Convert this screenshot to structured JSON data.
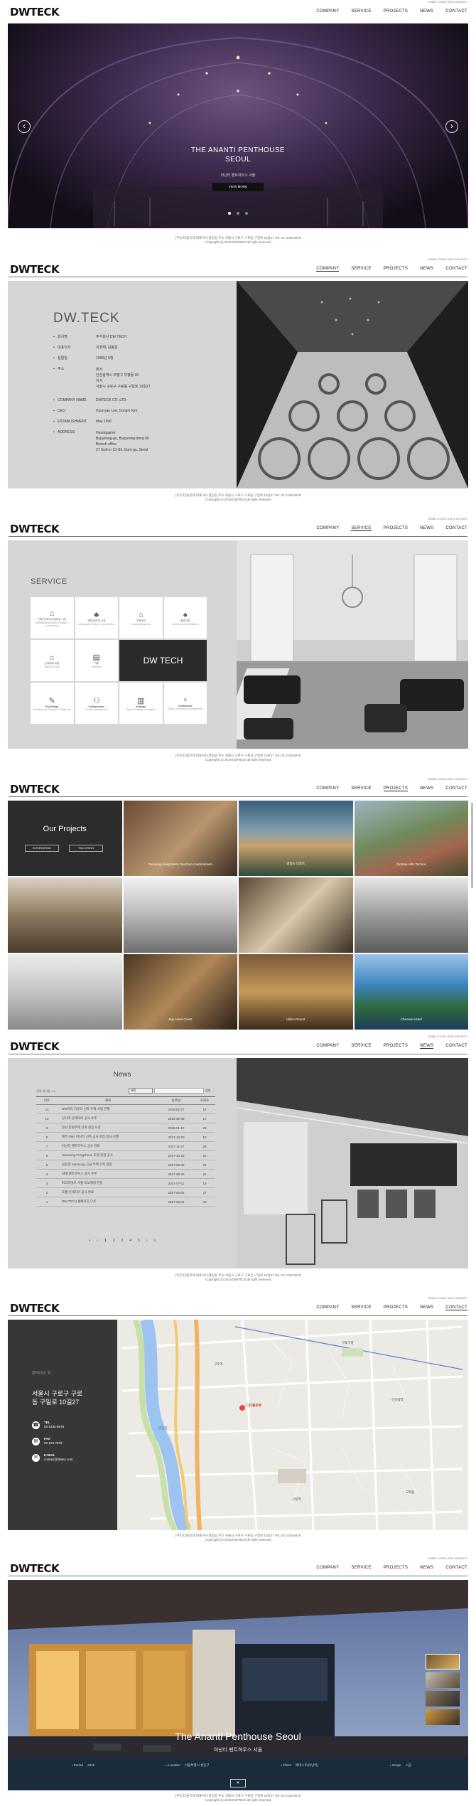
{
  "brand": "DWTECK",
  "nav": [
    "COMPANY",
    "SERVICE",
    "PROJECTS",
    "NEWS",
    "CONTACT"
  ],
  "util": "HOME  LOGIN  JOIN  CONTACT",
  "footer": {
    "line1": "(주)디더블유텍 대표이사 홍길동 주소 서울시 구로구 구로동 구일로 10길27 Tel. 02-1234-5678",
    "line2": "Copyright (c) 2018 DWTECK all right reserved"
  },
  "hero": {
    "title1": "THE ANANTI PENTHOUSE",
    "title2": "SEOUL",
    "sub": "아난티 펜트하우스 서울",
    "btn": "VIEW MORE",
    "prev": "‹",
    "next": "›"
  },
  "company": {
    "title": "DW.TECK",
    "rows": [
      {
        "k": "회사명",
        "v": "주식회사 DW TECH"
      },
      {
        "k": "대표이사",
        "v": "이현재, 김동일"
      },
      {
        "k": "설립일",
        "v": "1996년 5월"
      },
      {
        "k": "주소",
        "v": "본사\n인천광역시 부평구 부평동 00\n지사\n서울시 구로구 구로동 구일로 10길27"
      },
      {
        "k": "COMPANY NAME",
        "v": "DWTECK CO.,LTD."
      },
      {
        "k": "CEO",
        "v": "Hyun-jae Lee, Dong-il Kim"
      },
      {
        "k": "ESTABLISHMENT",
        "v": "May 1996"
      },
      {
        "k": "ADDRESS",
        "v": "Headquarter\nBupyeong-gu, Bupyeong-dong 00\nBranch office\n27 Guil-ro 10-Gil, Guro-gu, Seoul"
      }
    ]
  },
  "service": {
    "title": "SERVICE",
    "center": "DW TECH",
    "items": [
      {
        "ko": "건축 인테리어 설계 및 시공",
        "en": "Architectural Interior Design & Construction"
      },
      {
        "ko": "조경 설계 및 시공",
        "en": "Landscape Design & Construction"
      },
      {
        "ko": "주택사업",
        "en": "Housing Business"
      },
      {
        "ko": "환경사업",
        "en": "Environmental Business"
      },
      {
        "ko": "인테리어 소품",
        "en": "Interior Props"
      },
      {
        "ko": "기획",
        "en": "Planning"
      },
      {
        "ko": "Pre-Design",
        "en": "Architectural Program & Planning"
      },
      {
        "ko": "Collaboration",
        "en": "Design Management"
      },
      {
        "ko": "Strategy",
        "en": "Space Strategy & Analysis"
      },
      {
        "ko": "Constructio",
        "en": "Total Construction Management"
      }
    ]
  },
  "projects": {
    "title": "Our Projects",
    "btn1": "INTERIORING",
    "btn2": "TBC-DRING",
    "captions": [
      "Samsung Hongcheon Seochon condominium",
      "영종도 리조트",
      "Jeju Hotel",
      "Gimhae Hills Terrace",
      "",
      "",
      "",
      "",
      "",
      "Jeju Hotel Guest",
      "Hilton Resort",
      "Cheonan Hotel",
      "",
      "",
      ""
    ]
  },
  "news": {
    "title": "News",
    "total": "전체 게시물 : 11",
    "select": "제목",
    "search": "검색",
    "cols": [
      "번호",
      "제목",
      "등록일",
      "조회수"
    ],
    "rows": [
      [
        "11",
        "DW아이 카운티 신축 주택 사업 진행",
        "2018-02-27",
        "12"
      ],
      [
        "10",
        "신사역 인테리어 공사 수주",
        "2018-02-08",
        "17"
      ],
      [
        "9",
        "동탄 전원주택 신축 현장 시작",
        "2018-01-18",
        "21"
      ],
      [
        "8",
        "제주 Parc 아난티 신축 공사 현장 답사 진행",
        "2017-12-20",
        "18"
      ],
      [
        "7",
        "아난티 펜트하우스 공사 완료",
        "2017-11-27",
        "26"
      ],
      [
        "6",
        "Samsung Hongcheon 조경 현장 공사",
        "2017-10-18",
        "22"
      ],
      [
        "5",
        "김천경 Samsung 고급 주택 신축 현장",
        "2017-09-05",
        "25"
      ],
      [
        "4",
        "남해 펜트하우스 공사 수주",
        "2017-08-20",
        "31"
      ],
      [
        "3",
        "파크하얏트 서울 리모델링 현장",
        "2017-07-11",
        "19"
      ],
      [
        "2",
        "호텔 인테리어 공사 완료",
        "2017-06-02",
        "27"
      ],
      [
        "1",
        "DW TECH 홈페이지 오픈",
        "2017-05-01",
        "40"
      ]
    ],
    "pages": [
      "«",
      "‹",
      "1",
      "2",
      "3",
      "4",
      "5",
      "›",
      "»"
    ]
  },
  "contact": {
    "label": "찾아오시는 길",
    "addr1": "서울시 구로구 구로",
    "addr2": "동 구일로 10길27",
    "tel_k": "TEL",
    "tel": "02-1234-5678",
    "fax_k": "FAX",
    "fax": "02-123-7878",
    "mail_k": "E-MAIL",
    "mail": "contact@dwtec.com",
    "map_pin": "디더블유텍",
    "map_labels": [
      "구로구청",
      "구로역",
      "신도림역",
      "안양천",
      "구일역",
      "고척동"
    ]
  },
  "gallery": {
    "title": "The Ananti Penthouse Seoul",
    "sub": "아난티 펜트하우스 서울",
    "meta": [
      {
        "k": "Period",
        "v": "2016"
      },
      {
        "k": "Location",
        "v": "서울특별시 성동구"
      },
      {
        "k": "Client",
        "v": "에머스트(아난티)"
      },
      {
        "k": "Scope",
        "v": "시공"
      }
    ]
  },
  "colors": {
    "accent": "#222222",
    "gray": "#d3d3d3",
    "dark": "#2b2b2b"
  }
}
